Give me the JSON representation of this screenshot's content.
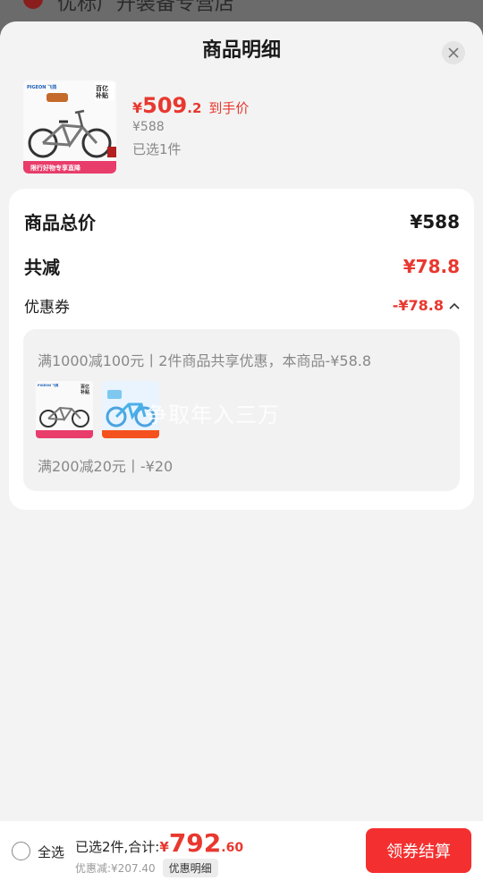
{
  "background_page": {
    "text": "优标广开装备专营店"
  },
  "sheet": {
    "title": "商品明细"
  },
  "product": {
    "price_currency": "¥",
    "price_int": "509",
    "price_dec": ".2",
    "price_label": "到手价",
    "original_price": "¥588",
    "selected_count": "已选1件",
    "thumb_brand": "PIGEON 飞鸽",
    "thumb_banner": "限行好物专享直降",
    "thumb_badge": "百亿补贴"
  },
  "summary": {
    "total_label": "商品总价",
    "total_value": "¥588",
    "reduce_label": "共减",
    "reduce_value": "¥78.8",
    "coupon_label": "优惠券",
    "coupon_value": "-¥78.8"
  },
  "coupons": {
    "line1": "满1000减100元丨2件商品共享优惠，本商品-¥58.8",
    "line2": "满200减20元丨-¥20",
    "watermark": "争取年入三万"
  },
  "bottom": {
    "select_all": "全选",
    "total_prefix": "已选2件,合计:",
    "total_currency": "¥",
    "total_int": "792",
    "total_dec": ".60",
    "saving": "优惠减:¥207.40",
    "detail_chip": "优惠明细",
    "checkout": "领券结算"
  },
  "colors": {
    "accent_red": "#e8382f",
    "button_red": "#f42f2f"
  },
  "icons": [
    "close-icon",
    "chevron-up-icon"
  ]
}
